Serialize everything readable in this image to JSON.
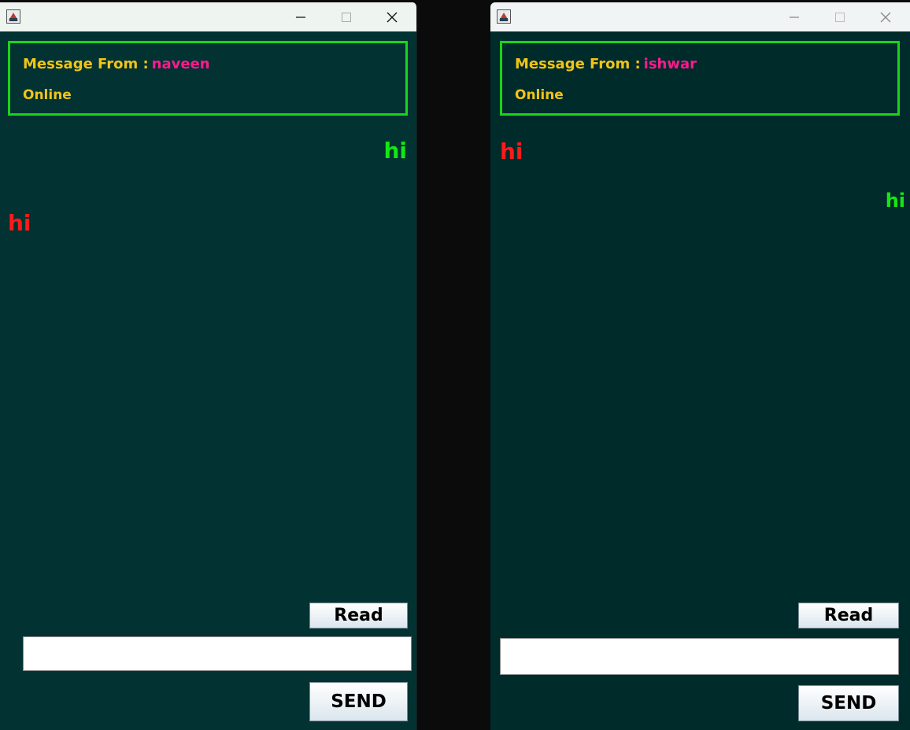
{
  "windows": [
    {
      "id": "left",
      "header": {
        "from_label": "Message From :",
        "from_name": "naveen",
        "status": "Online"
      },
      "messages": [
        {
          "text": "hi",
          "direction": "sent"
        },
        {
          "text": "hi",
          "direction": "received"
        }
      ],
      "read_label": "Read",
      "message_input": {
        "value": "",
        "placeholder": ""
      },
      "send_label": "SEND"
    },
    {
      "id": "right",
      "header": {
        "from_label": "Message From :",
        "from_name": "ishwar",
        "status": "Online"
      },
      "messages": [
        {
          "text": "hi",
          "direction": "received"
        },
        {
          "text": "hi",
          "direction": "sent"
        }
      ],
      "read_label": "Read",
      "message_input": {
        "value": "",
        "placeholder": ""
      },
      "send_label": "SEND"
    }
  ],
  "colors": {
    "chat_background": "#023232",
    "header_border": "#19d419",
    "label_color": "#f0c419",
    "name_color": "#ff1a8c",
    "sent_color": "#13e813",
    "received_color": "#ff1a1a"
  },
  "icons": [
    "java-app-icon",
    "minimize-icon",
    "maximize-icon",
    "close-icon"
  ]
}
